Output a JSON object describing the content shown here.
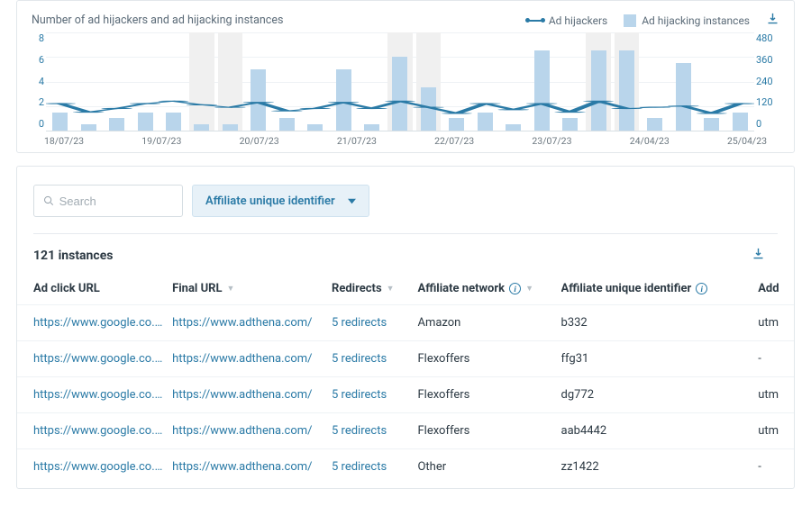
{
  "chart_data": {
    "type": "bar+line",
    "title": "Number of ad hijackers and ad hijacking instances",
    "legend": {
      "line": "Ad hijackers",
      "bars": "Ad hijacking instances"
    },
    "left_axis": {
      "label": "",
      "ticks": [
        8,
        6,
        4,
        2,
        0
      ]
    },
    "right_axis": {
      "label": "",
      "ticks": [
        480,
        360,
        240,
        120,
        0
      ]
    },
    "x_labels": [
      "18/07/23",
      "19/07/23",
      "20/07/23",
      "21/07/23",
      "22/07/23",
      "23/07/23",
      "24/04/23",
      "25/04/23"
    ],
    "bg_highlight": [
      0,
      0,
      0,
      0,
      0,
      1,
      1,
      0,
      0,
      0,
      0,
      0,
      1,
      1,
      0,
      0,
      0,
      0,
      0,
      1,
      1,
      0,
      0,
      0,
      0
    ],
    "bar_values": [
      90,
      30,
      60,
      90,
      90,
      30,
      30,
      300,
      60,
      30,
      300,
      30,
      360,
      210,
      60,
      90,
      30,
      390,
      60,
      390,
      390,
      60,
      330,
      60,
      90
    ],
    "line_values": [
      2.2,
      1.5,
      1.8,
      2.2,
      2.4,
      2.1,
      1.9,
      2.3,
      1.6,
      1.8,
      2.3,
      1.8,
      2.4,
      1.9,
      1.4,
      2.2,
      1.7,
      2.2,
      1.5,
      2.4,
      1.8,
      1.9,
      2.0,
      1.4,
      2.2
    ],
    "ylim_left": [
      0,
      8
    ],
    "ylim_right": [
      0,
      480
    ]
  },
  "search": {
    "placeholder": "Search"
  },
  "filter": {
    "label": "Affiliate unique identifier"
  },
  "count_label": "121 instances",
  "headers": {
    "c1": "Ad click URL",
    "c2": "Final URL",
    "c3": "Redirects",
    "c4": "Affiliate network",
    "c5": "Affiliate unique identifier",
    "c6": "Add"
  },
  "rows": [
    {
      "c1": "https://www.google.co.uk",
      "c2": "https://www.adthena.com/",
      "c3": "5 redirects",
      "c4": "Amazon",
      "c5": "b332",
      "c6": "utm"
    },
    {
      "c1": "https://www.google.co.uk",
      "c2": "https://www.adthena.com/",
      "c3": "5 redirects",
      "c4": "Flexoffers",
      "c5": "ffg31",
      "c6": "-"
    },
    {
      "c1": "https://www.google.co.uk",
      "c2": "https://www.adthena.com/",
      "c3": "5 redirects",
      "c4": "Flexoffers",
      "c5": "dg772",
      "c6": "utm"
    },
    {
      "c1": "https://www.google.co.uk",
      "c2": "https://www.adthena.com/",
      "c3": "5 redirects",
      "c4": "Flexoffers",
      "c5": "aab4442",
      "c6": "utm"
    },
    {
      "c1": "https://www.google.co.uk",
      "c2": "https://www.adthena.com/",
      "c3": "5 redirects",
      "c4": "Other",
      "c5": "zz1422",
      "c6": "-"
    }
  ]
}
